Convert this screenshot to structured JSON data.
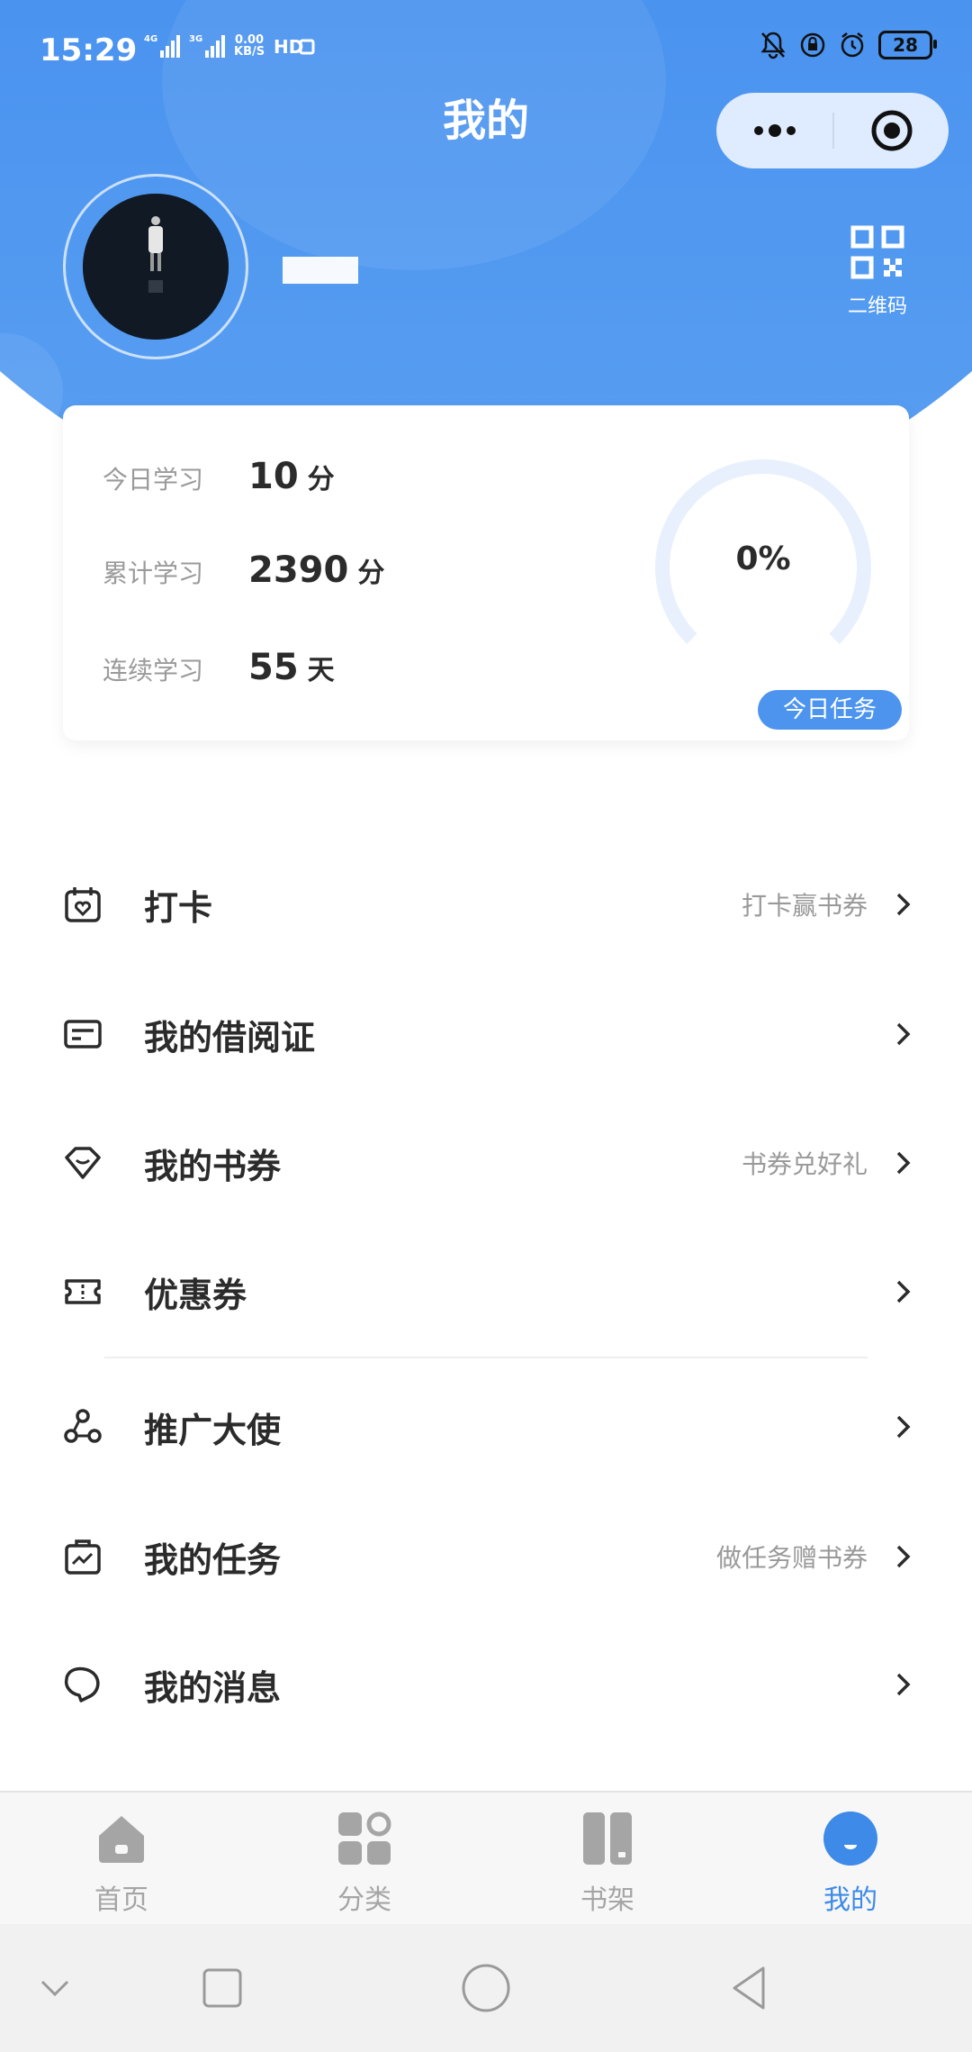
{
  "status_bar": {
    "time": "15:29",
    "network_1": "4G",
    "network_2": "3G",
    "speed_value": "0.00",
    "speed_unit": "KB/S",
    "hd_label": "HD",
    "battery": "28"
  },
  "header": {
    "title": "我的",
    "qrcode_label": "二维码"
  },
  "stats": {
    "today_label": "今日学习",
    "today_value": "10",
    "today_unit": "分",
    "total_label": "累计学习",
    "total_value": "2390",
    "total_unit": "分",
    "streak_label": "连续学习",
    "streak_value": "55",
    "streak_unit": "天",
    "task_progress_text": "0%",
    "task_progress": 0,
    "task_badge": "今日任务"
  },
  "menu": {
    "items": [
      {
        "label": "打卡",
        "hint": "打卡赢书券",
        "icon": "calendar-heart-icon"
      },
      {
        "label": "我的借阅证",
        "hint": "",
        "icon": "library-card-icon"
      },
      {
        "label": "我的书券",
        "hint": "书券兑好礼",
        "icon": "voucher-icon"
      },
      {
        "label": "优惠券",
        "hint": "",
        "icon": "coupon-icon"
      },
      {
        "label": "推广大使",
        "hint": "",
        "icon": "share-icon"
      },
      {
        "label": "我的任务",
        "hint": "做任务赠书券",
        "icon": "task-briefcase-icon"
      },
      {
        "label": "我的消息",
        "hint": "",
        "icon": "message-icon"
      }
    ]
  },
  "tabbar": {
    "items": [
      {
        "label": "首页",
        "icon": "home-icon"
      },
      {
        "label": "分类",
        "icon": "category-icon"
      },
      {
        "label": "书架",
        "icon": "bookshelf-icon"
      },
      {
        "label": "我的",
        "icon": "profile-icon"
      }
    ],
    "active_index": 3
  },
  "colors": {
    "brand_blue": "#4a93ef",
    "active_tab": "#3d8ae8",
    "text_dark": "#2b2b2b",
    "text_muted": "#999999"
  }
}
